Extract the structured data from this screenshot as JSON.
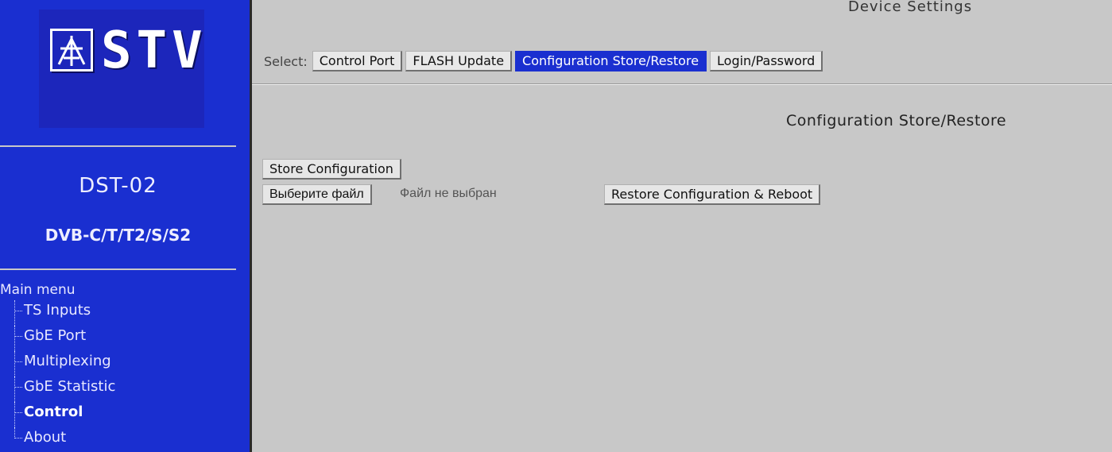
{
  "brand": {
    "logo_text": "STV"
  },
  "device": {
    "model": "DST-02",
    "standard": "DVB-C/T/T2/S/S2"
  },
  "menu": {
    "title": "Main menu",
    "items": [
      {
        "label": "TS Inputs",
        "active": false
      },
      {
        "label": "GbE Port",
        "active": false
      },
      {
        "label": "Multiplexing",
        "active": false
      },
      {
        "label": "GbE Statistic",
        "active": false
      },
      {
        "label": "Control",
        "active": true
      },
      {
        "label": "About",
        "active": false
      }
    ]
  },
  "page": {
    "title": "Device Settings"
  },
  "select": {
    "label": "Select:",
    "tabs": [
      {
        "label": "Control Port",
        "selected": false
      },
      {
        "label": "FLASH Update",
        "selected": false
      },
      {
        "label": "Configuration Store/Restore",
        "selected": true
      },
      {
        "label": "Login/Password",
        "selected": false
      }
    ]
  },
  "section": {
    "title": "Configuration Store/Restore",
    "store_button": "Store Configuration",
    "file_button": "Выберите файл",
    "file_status": "Файл не выбран",
    "restore_button": "Restore Configuration & Reboot"
  },
  "colors": {
    "sidebar": "#1a2fd0",
    "content_bg": "#c8c8c8",
    "selected_tab": "#1a2fd0"
  }
}
